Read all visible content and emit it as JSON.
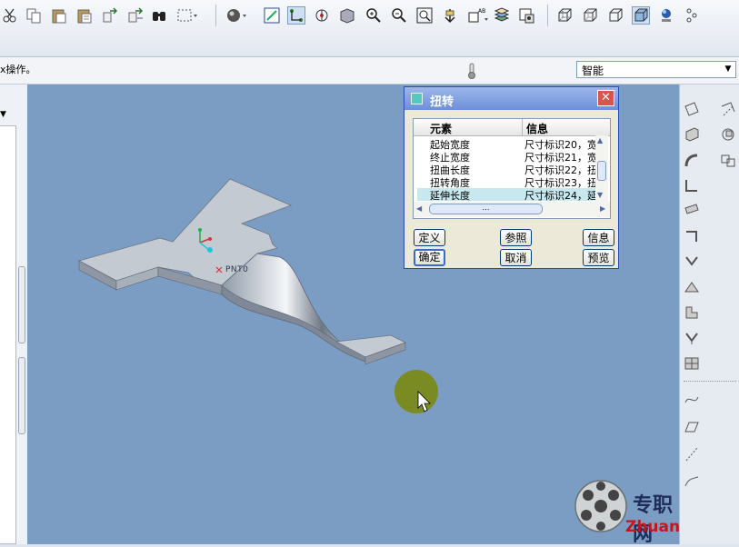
{
  "toolbar": {
    "icons": [
      "cut-icon",
      "copy-icon",
      "paste-icon",
      "paste-special-icon",
      "regenerate-icon",
      "regen-manager-icon",
      "find-icon",
      "select-box-icon",
      "shading-icon",
      "repaint-icon",
      "orient-icon",
      "spin-center-icon",
      "saved-view-icon",
      "zoom-in-icon",
      "zoom-out-icon",
      "refit-icon",
      "reorient-icon",
      "datum-display-icon",
      "layers-icon",
      "view-manager-icon",
      "wireframe-icon",
      "hidden-line-icon",
      "no-hidden-icon",
      "shaded-icon",
      "model-tree-icon",
      "datum-points-icon"
    ]
  },
  "message": {
    "text": "x操作。",
    "filter_value": "智能"
  },
  "dialog": {
    "title": "扭转",
    "headers": {
      "element": "元素",
      "info": "信息"
    },
    "rows": [
      {
        "element": "起始宽度",
        "info": "尺寸标识20，宽"
      },
      {
        "element": "终止宽度",
        "info": "尺寸标识21，宽"
      },
      {
        "element": "扭曲长度",
        "info": "尺寸标识22，扭"
      },
      {
        "element": "扭转角度",
        "info": "尺寸标识23，扭"
      },
      {
        "element": "延伸长度",
        "info": "尺寸标识24，延"
      }
    ],
    "selected_row": 4,
    "buttons": {
      "define": "定义",
      "refs": "参照",
      "info": "信息",
      "ok": "确定",
      "cancel": "取消",
      "preview": "预览"
    }
  },
  "viewport": {
    "point_label": "PNT0",
    "background_color": "#7b9cc3"
  },
  "watermark": {
    "cn": "专职网",
    "url": "Zhuanzhi.Net"
  }
}
